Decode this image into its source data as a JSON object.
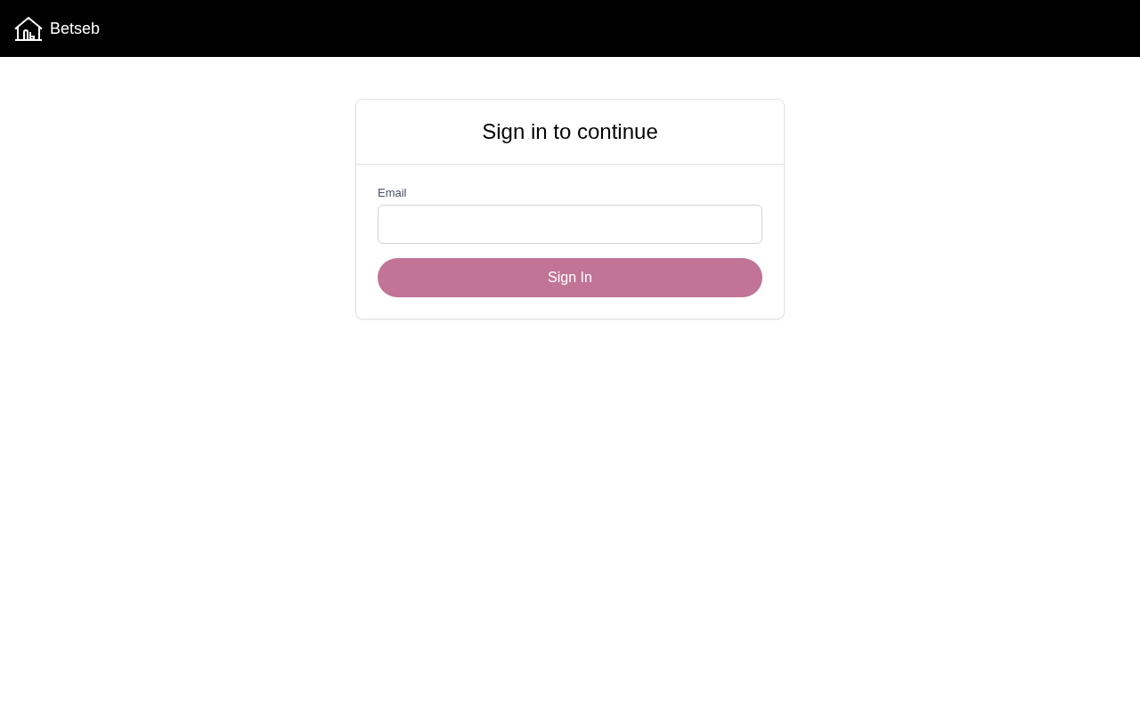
{
  "header": {
    "brand": "Betseb"
  },
  "card": {
    "title": "Sign in to continue",
    "email": {
      "label": "Email"
    },
    "submit": {
      "label": "Sign In"
    }
  }
}
